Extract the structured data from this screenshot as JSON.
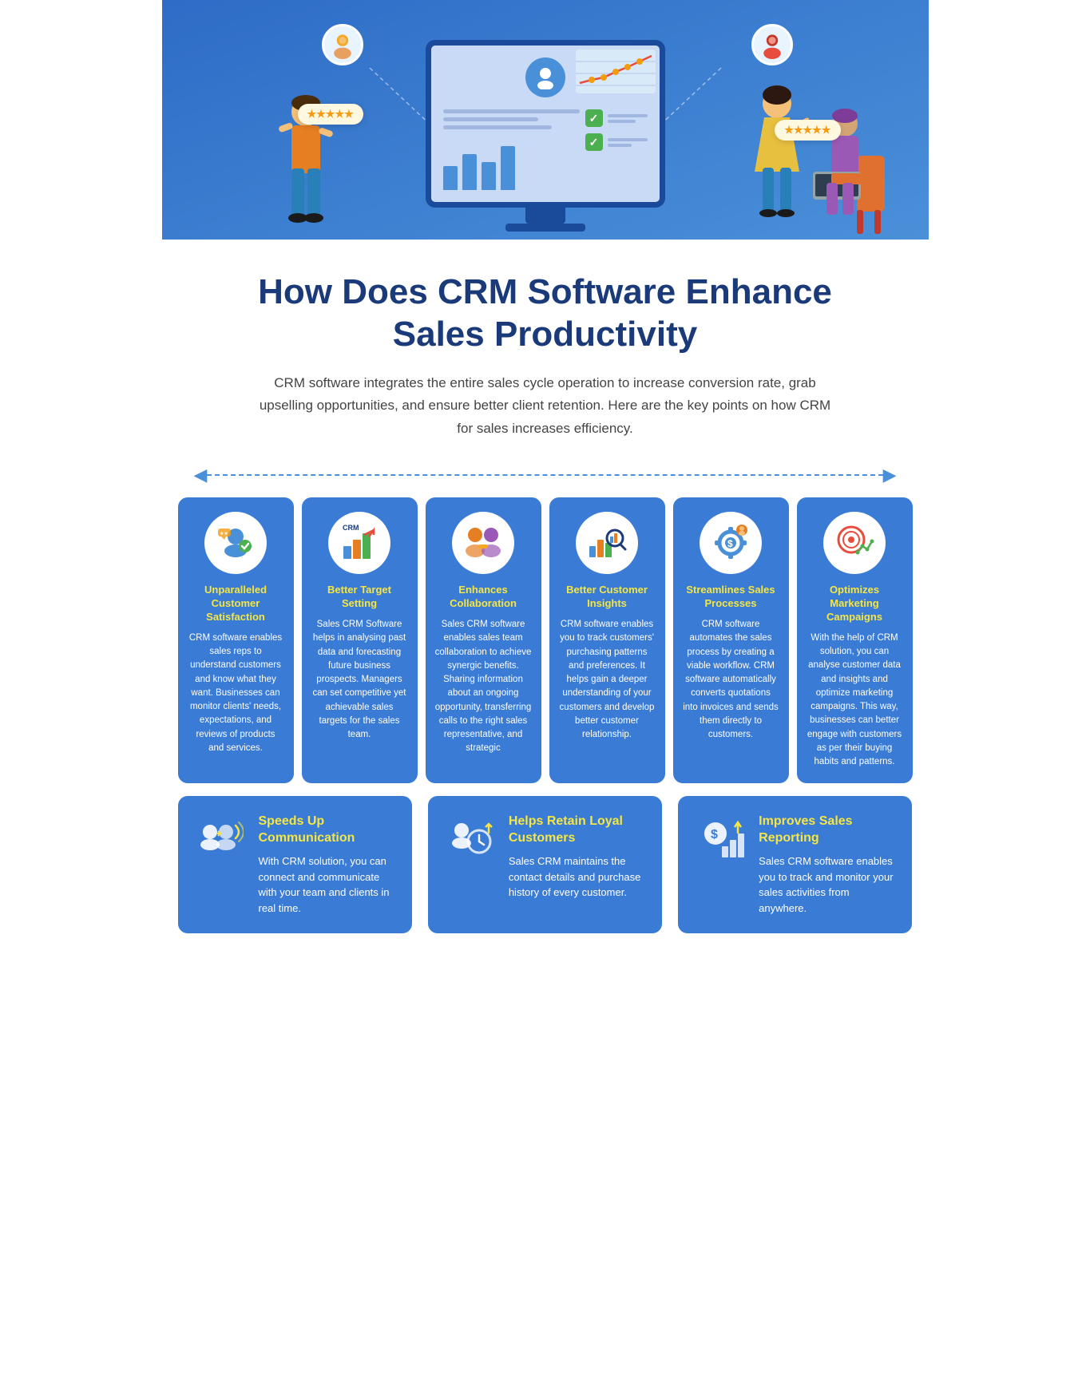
{
  "hero": {
    "bg_color": "#3a7bd5"
  },
  "title": {
    "main": "How Does CRM Software Enhance Sales Productivity",
    "subtitle": "CRM software integrates the entire sales cycle operation to increase conversion rate, grab upselling opportunities, and ensure better client retention. Here are the key points on how CRM for sales increases efficiency."
  },
  "cards_top": [
    {
      "id": "unparalleled-customer-satisfaction",
      "title": "Unparalleled Customer Satisfaction",
      "text": "CRM software enables sales reps to understand customers and know what they want. Businesses can monitor clients' needs, expectations, and reviews of products and services."
    },
    {
      "id": "better-target-setting",
      "title": "Better Target Setting",
      "text": "Sales CRM Software helps in analysing past data and forecasting future business prospects. Managers can set competitive yet achievable sales targets for the sales team."
    },
    {
      "id": "enhances-collaboration",
      "title": "Enhances Collaboration",
      "text": "Sales CRM software enables sales team collaboration to achieve synergic benefits. Sharing information about an ongoing opportunity, transferring calls to the right sales representative, and strategic"
    },
    {
      "id": "better-customer-insights",
      "title": "Better Customer Insights",
      "text": "CRM software enables you to track customers' purchasing patterns and preferences. It helps gain a deeper understanding of your customers and develop better customer relationship."
    },
    {
      "id": "streamlines-sales-processes",
      "title": "Streamlines Sales Processes",
      "text": "CRM software automates the sales process by creating a viable workflow. CRM software automatically converts quotations into invoices and sends them directly to customers."
    },
    {
      "id": "optimizes-marketing-campaigns",
      "title": "Optimizes Marketing Campaigns",
      "text": "With the help of CRM solution, you can analyse customer data and insights and optimize marketing campaigns. This way, businesses can better engage with customers as per their buying habits and patterns."
    }
  ],
  "cards_bottom": [
    {
      "id": "speeds-up-communication",
      "title": "Speeds Up Communication",
      "text": "With CRM solution, you can connect and communicate with your team and clients in real time."
    },
    {
      "id": "helps-retain-loyal-customers",
      "title": "Helps Retain Loyal Customers",
      "text": "Sales CRM maintains the contact details and purchase history of every customer."
    },
    {
      "id": "improves-sales-reporting",
      "title": "Improves Sales Reporting",
      "text": "Sales CRM software enables you to track and monitor your sales activities from anywhere."
    }
  ]
}
